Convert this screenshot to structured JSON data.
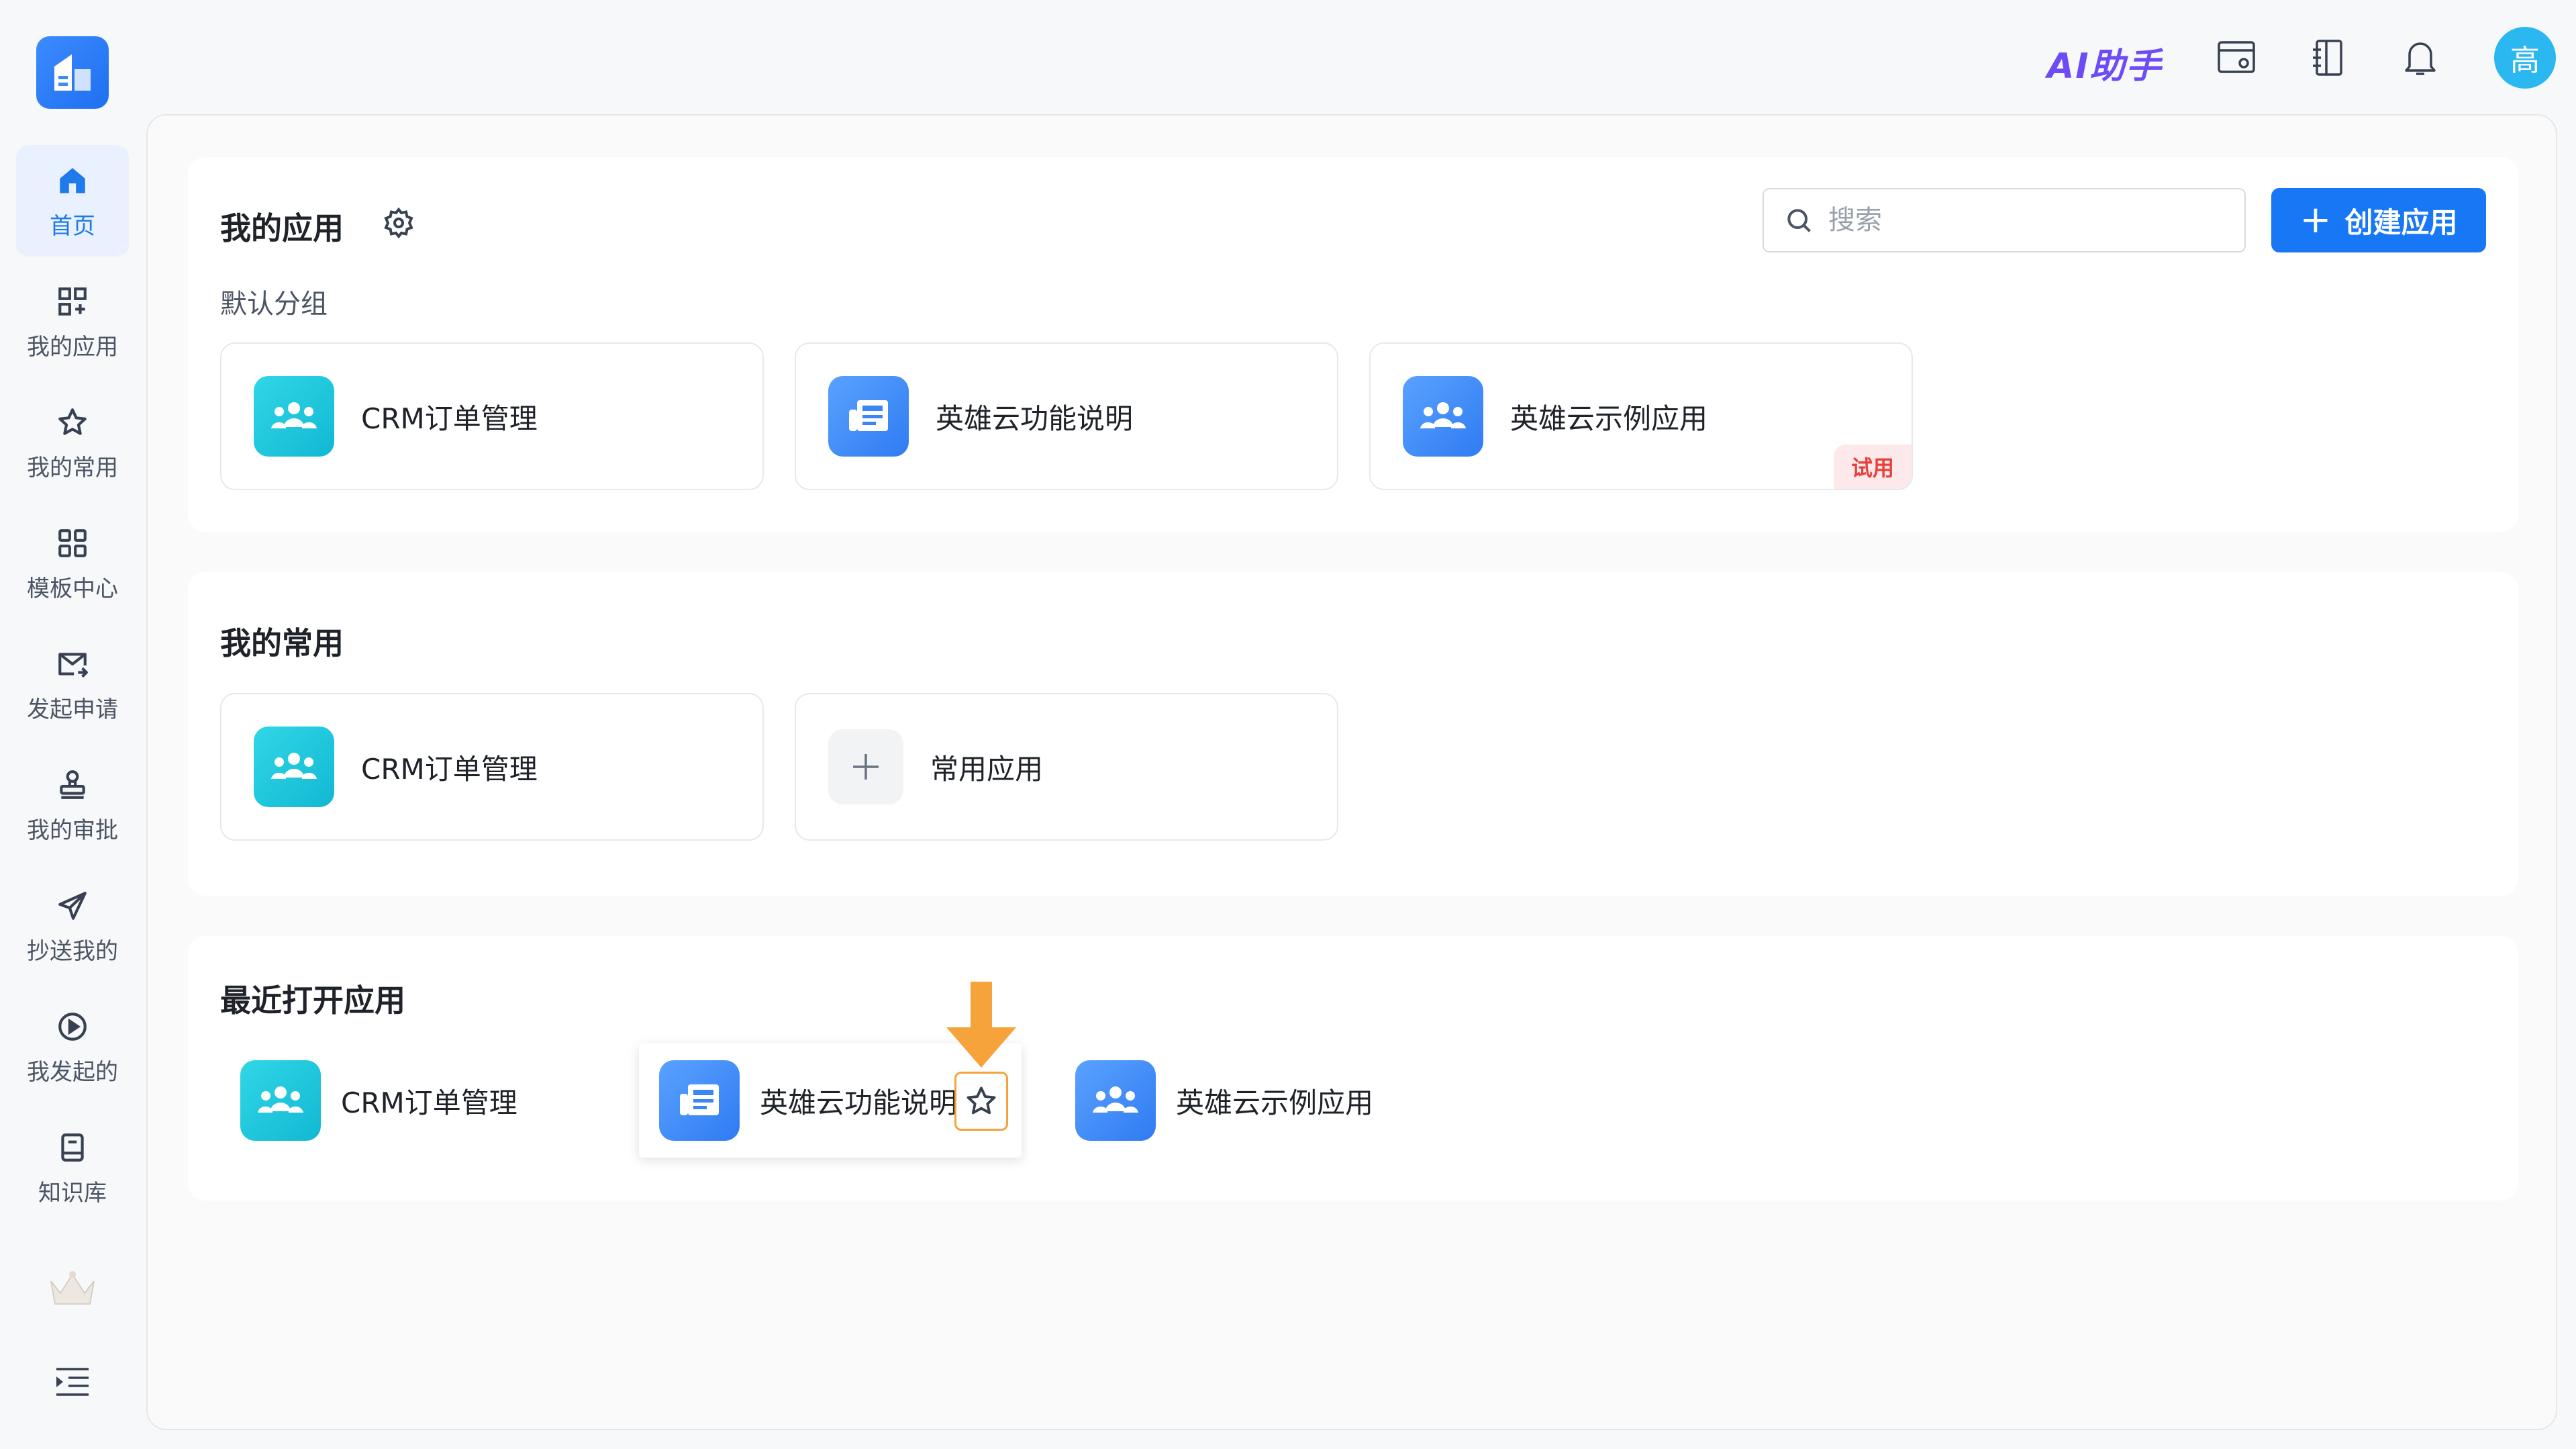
{
  "sidebar": {
    "items": [
      {
        "label": "首页",
        "icon": "home-icon"
      },
      {
        "label": "我的应用",
        "icon": "grid-plus-icon"
      },
      {
        "label": "我的常用",
        "icon": "star-icon"
      },
      {
        "label": "模板中心",
        "icon": "template-grid-icon"
      },
      {
        "label": "发起申请",
        "icon": "mail-send-icon"
      },
      {
        "label": "我的审批",
        "icon": "stamp-icon"
      },
      {
        "label": "抄送我的",
        "icon": "paper-plane-icon"
      },
      {
        "label": "我发起的",
        "icon": "play-circle-icon"
      },
      {
        "label": "知识库",
        "icon": "book-icon"
      }
    ],
    "active": "首页"
  },
  "topbar": {
    "ai_label": "AI助手",
    "avatar_text": "高"
  },
  "my_apps": {
    "title": "我的应用",
    "group_label": "默认分组",
    "search_placeholder": "搜索",
    "create_button": "创建应用",
    "cards": [
      {
        "name": "CRM订单管理",
        "icon": "team-icon",
        "color": "#1fc6dc"
      },
      {
        "name": "英雄云功能说明",
        "icon": "news-icon",
        "color": "#3a86f7"
      },
      {
        "name": "英雄云示例应用",
        "icon": "team-icon",
        "color": "#3a86f7",
        "badge": "试用"
      }
    ]
  },
  "frequent": {
    "title": "我的常用",
    "cards": [
      {
        "name": "CRM订单管理",
        "icon": "team-icon"
      },
      {
        "name": "常用应用",
        "icon": "plus-icon"
      }
    ]
  },
  "recent": {
    "title": "最近打开应用",
    "items": [
      {
        "name": "CRM订单管理",
        "icon": "team-icon"
      },
      {
        "name": "英雄云功能说明",
        "icon": "news-icon"
      },
      {
        "name": "英雄云示例应用",
        "icon": "team-icon"
      }
    ]
  },
  "colors": {
    "accent": "#1777f5",
    "highlight": "#f5a33a",
    "trial_badge": "#e8413d"
  }
}
